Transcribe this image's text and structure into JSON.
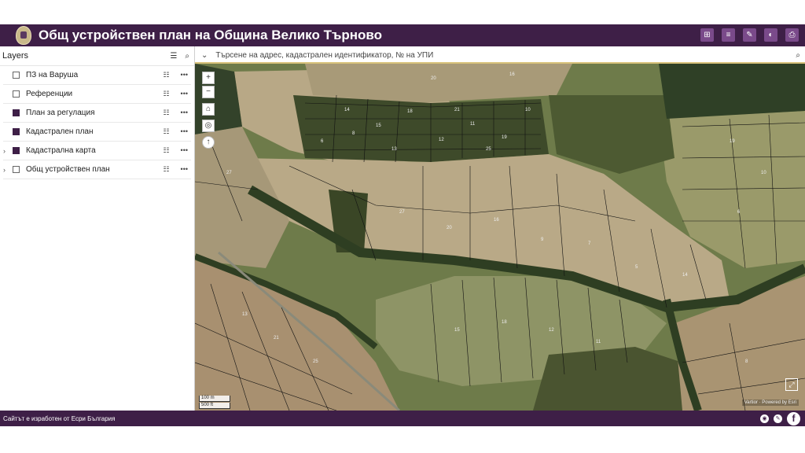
{
  "header": {
    "title": "Общ устройствен план на Община Велико Търново",
    "logo_icon": "coat-of-arms-icon",
    "tools": [
      {
        "name": "basemap-gallery-icon",
        "glyph": "⊞"
      },
      {
        "name": "layer-list-icon",
        "glyph": "≡"
      },
      {
        "name": "measure-icon",
        "glyph": "✎"
      },
      {
        "name": "draw-icon",
        "glyph": "◐"
      },
      {
        "name": "print-icon",
        "glyph": "⎙"
      }
    ]
  },
  "layers_panel": {
    "title": "Layers",
    "items": [
      {
        "label": "ПЗ на Варуша",
        "checked": false,
        "expandable": false
      },
      {
        "label": "Референции",
        "checked": false,
        "expandable": false
      },
      {
        "label": "План за регулация",
        "checked": true,
        "expandable": false
      },
      {
        "label": "Кадастрален план",
        "checked": true,
        "expandable": false
      },
      {
        "label": "Кадастрална карта",
        "checked": true,
        "expandable": true
      },
      {
        "label": "Общ устройствен план",
        "checked": false,
        "expandable": true
      }
    ]
  },
  "search": {
    "placeholder": "Търсене на адрес, кадастрален идентификатор, № на УПИ"
  },
  "map": {
    "zoom_in": "+",
    "zoom_out": "−",
    "scale_metric": "100 m",
    "scale_imperial": "500 ft",
    "attribution": "Vartior · Powered by Esri",
    "parcel_numbers": [
      "14",
      "15",
      "18",
      "12",
      "11",
      "19",
      "10",
      "6",
      "8",
      "13",
      "21",
      "25",
      "27",
      "20",
      "16",
      "9",
      "7",
      "5"
    ]
  },
  "footer": {
    "text": "Сайтът е изработен от Есри България"
  },
  "colors": {
    "brand": "#3e1f47",
    "accent": "#7a4a8a"
  }
}
